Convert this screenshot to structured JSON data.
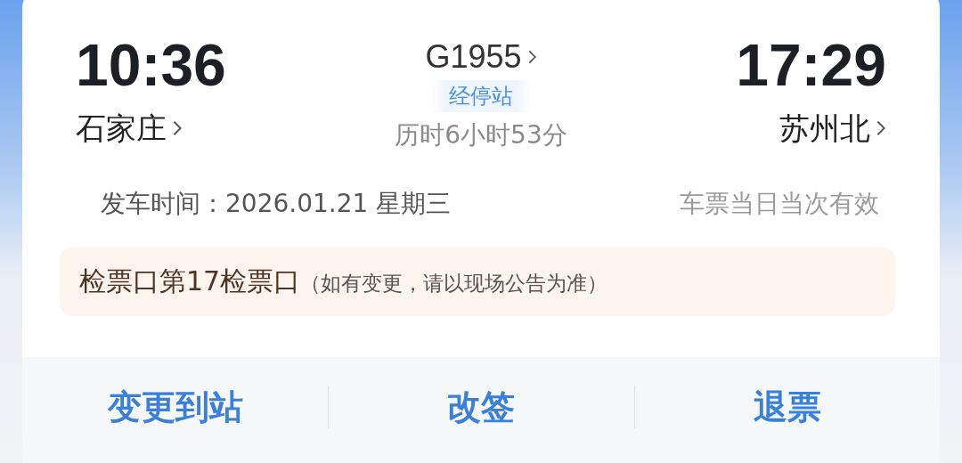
{
  "departure": {
    "time": "10:36",
    "station": "石家庄"
  },
  "arrival": {
    "time": "17:29",
    "station": "苏州北"
  },
  "train": {
    "number": "G1955",
    "stops_label": "经停站",
    "duration": "历时6小时53分"
  },
  "departure_date": {
    "label": "发车时间：",
    "value": "2026.01.21 星期三"
  },
  "validity": "车票当日当次有效",
  "gate": {
    "text": "检票口第17检票口",
    "note": "（如有变更，请以现场公告为准）"
  },
  "actions": [
    {
      "label": "变更到站"
    },
    {
      "label": "改签"
    },
    {
      "label": "退票"
    }
  ]
}
